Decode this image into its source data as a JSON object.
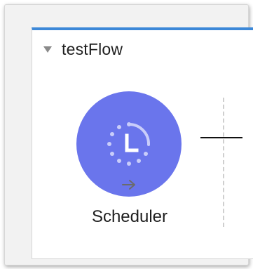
{
  "flow": {
    "name": "testFlow",
    "header_color": "#3c88d8"
  },
  "node": {
    "label": "Scheduler",
    "icon": "scheduler-clock-icon",
    "badge_icon": "arrow-right-icon",
    "color": "#6a75ec"
  }
}
